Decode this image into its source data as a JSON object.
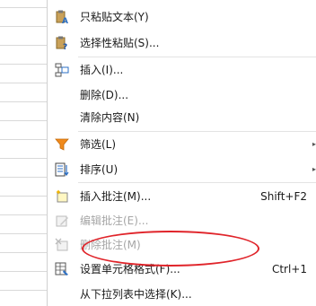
{
  "menu": {
    "items": [
      {
        "label": "只粘贴文本(Y)",
        "icon": "paste-text-icon",
        "shortcut": "",
        "disabled": false
      },
      {
        "label": "选择性粘贴(S)...",
        "icon": "paste-special-icon",
        "shortcut": "",
        "disabled": false
      },
      {
        "label": "插入(I)...",
        "icon": "insert-cells-icon",
        "shortcut": "",
        "disabled": false
      },
      {
        "label": "删除(D)...",
        "icon": "",
        "shortcut": "",
        "disabled": false
      },
      {
        "label": "清除内容(N)",
        "icon": "",
        "shortcut": "",
        "disabled": false
      },
      {
        "label": "筛选(L)",
        "icon": "filter-icon",
        "shortcut": "",
        "disabled": false,
        "submenu": true
      },
      {
        "label": "排序(U)",
        "icon": "sort-icon",
        "shortcut": "",
        "disabled": false,
        "submenu": true
      },
      {
        "label": "插入批注(M)...",
        "icon": "insert-comment-icon",
        "shortcut": "Shift+F2",
        "disabled": false
      },
      {
        "label": "编辑批注(E)...",
        "icon": "edit-comment-icon",
        "shortcut": "",
        "disabled": true
      },
      {
        "label": "删除批注(M)",
        "icon": "delete-comment-icon",
        "shortcut": "",
        "disabled": true
      },
      {
        "label": "设置单元格格式(F)...",
        "icon": "format-cells-icon",
        "shortcut": "Ctrl+1",
        "disabled": false,
        "highlighted": true
      },
      {
        "label": "从下拉列表中选择(K)...",
        "icon": "",
        "shortcut": "",
        "disabled": false
      }
    ],
    "arrow_glyph": "▸"
  },
  "colors": {
    "highlight_ellipse": "#e0242a",
    "filter_icon": "#f08a1c",
    "sort_icon": "#2b6fc4",
    "disabled_text": "#a6a6a6"
  }
}
